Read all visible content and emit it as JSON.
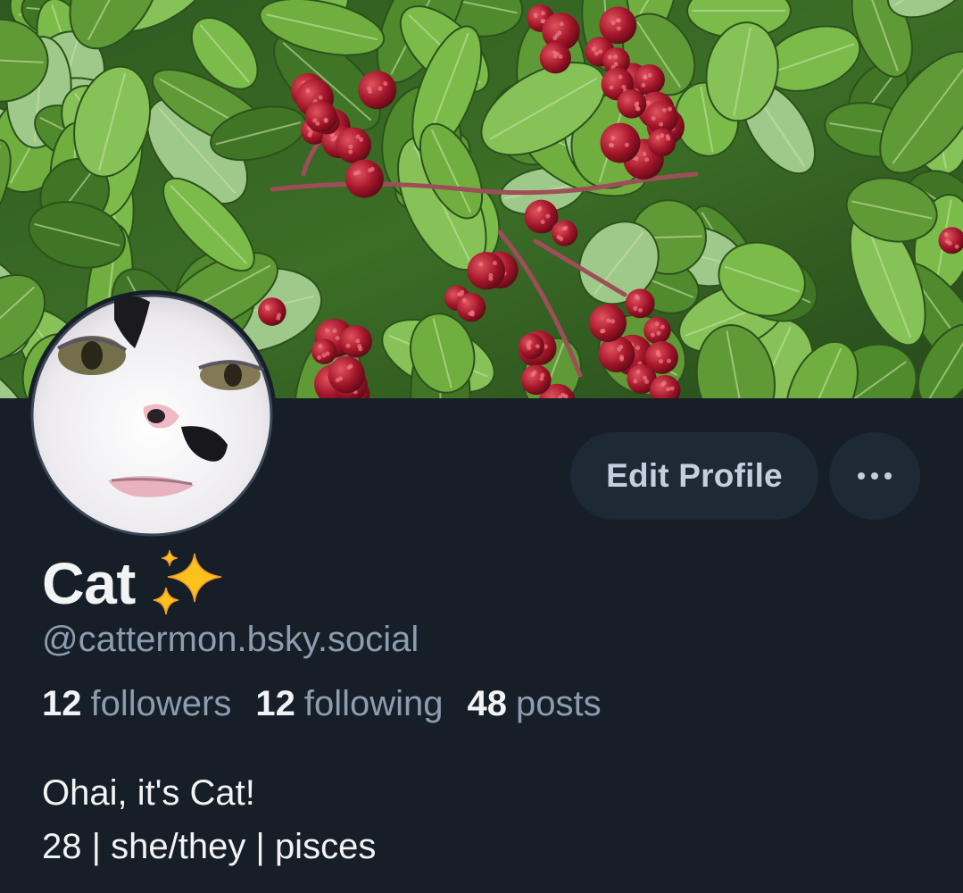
{
  "profile": {
    "display_name": "Cat",
    "name_emoji": "sparkles-emoji",
    "handle": "@cattermon.bsky.social",
    "banner_image": "blackberry bramble with red berries and green leaves",
    "avatar_image": "close-up of white cat face with black spots"
  },
  "actions": {
    "edit_label": "Edit Profile",
    "more_icon": "ellipsis-icon"
  },
  "stats": {
    "followers_count": "12",
    "followers_label": "followers",
    "following_count": "12",
    "following_label": "following",
    "posts_count": "48",
    "posts_label": "posts"
  },
  "bio": {
    "line1": "Ohai, it's Cat!",
    "line2": "28 | she/they | pisces"
  },
  "colors": {
    "background": "#161e27",
    "button_bg": "#1e2936",
    "text_primary": "#f1f3f5",
    "text_secondary": "#8d9cae"
  }
}
